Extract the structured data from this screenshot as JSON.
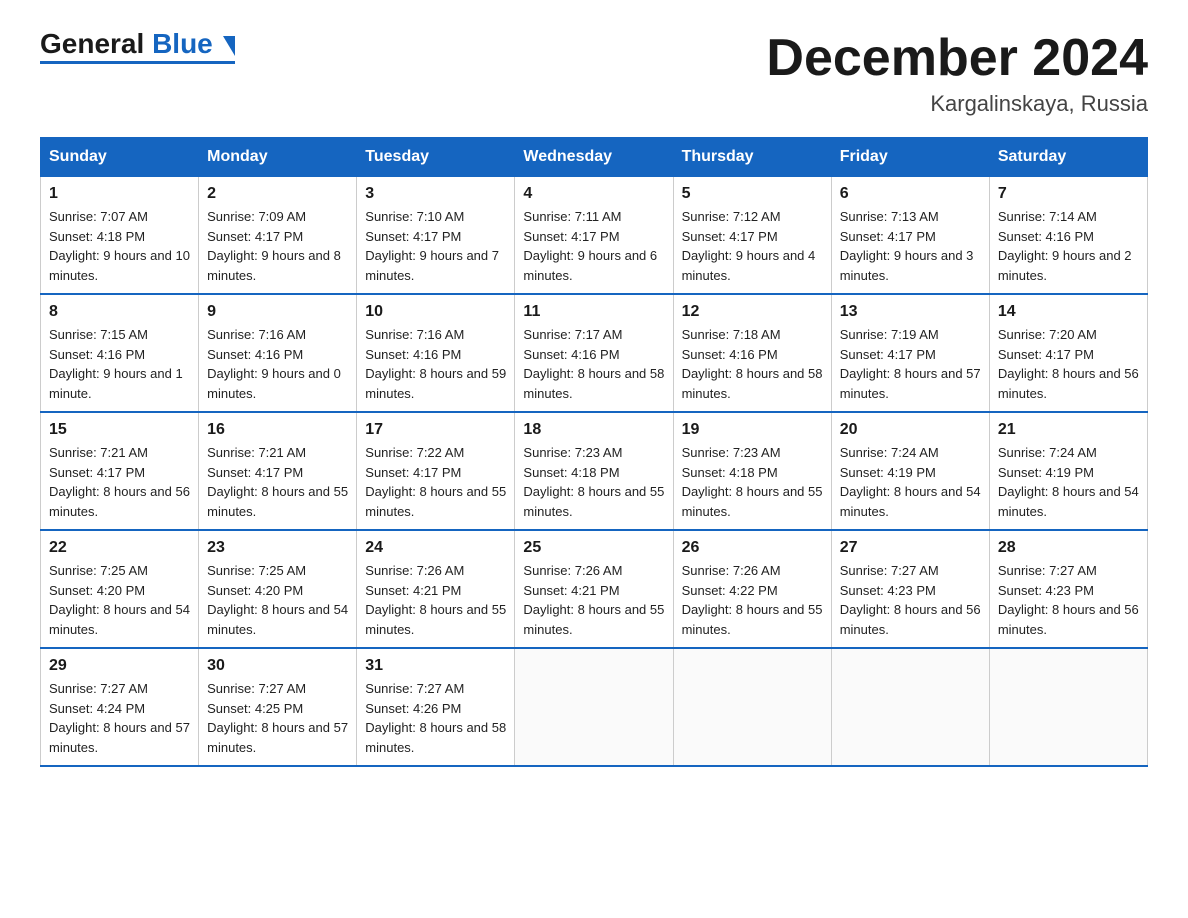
{
  "header": {
    "logo_general": "General",
    "logo_blue": "Blue",
    "month_title": "December 2024",
    "location": "Kargalinskaya, Russia"
  },
  "weekdays": [
    "Sunday",
    "Monday",
    "Tuesday",
    "Wednesday",
    "Thursday",
    "Friday",
    "Saturday"
  ],
  "weeks": [
    [
      {
        "day": "1",
        "sunrise": "7:07 AM",
        "sunset": "4:18 PM",
        "daylight": "9 hours and 10 minutes."
      },
      {
        "day": "2",
        "sunrise": "7:09 AM",
        "sunset": "4:17 PM",
        "daylight": "9 hours and 8 minutes."
      },
      {
        "day": "3",
        "sunrise": "7:10 AM",
        "sunset": "4:17 PM",
        "daylight": "9 hours and 7 minutes."
      },
      {
        "day": "4",
        "sunrise": "7:11 AM",
        "sunset": "4:17 PM",
        "daylight": "9 hours and 6 minutes."
      },
      {
        "day": "5",
        "sunrise": "7:12 AM",
        "sunset": "4:17 PM",
        "daylight": "9 hours and 4 minutes."
      },
      {
        "day": "6",
        "sunrise": "7:13 AM",
        "sunset": "4:17 PM",
        "daylight": "9 hours and 3 minutes."
      },
      {
        "day": "7",
        "sunrise": "7:14 AM",
        "sunset": "4:16 PM",
        "daylight": "9 hours and 2 minutes."
      }
    ],
    [
      {
        "day": "8",
        "sunrise": "7:15 AM",
        "sunset": "4:16 PM",
        "daylight": "9 hours and 1 minute."
      },
      {
        "day": "9",
        "sunrise": "7:16 AM",
        "sunset": "4:16 PM",
        "daylight": "9 hours and 0 minutes."
      },
      {
        "day": "10",
        "sunrise": "7:16 AM",
        "sunset": "4:16 PM",
        "daylight": "8 hours and 59 minutes."
      },
      {
        "day": "11",
        "sunrise": "7:17 AM",
        "sunset": "4:16 PM",
        "daylight": "8 hours and 58 minutes."
      },
      {
        "day": "12",
        "sunrise": "7:18 AM",
        "sunset": "4:16 PM",
        "daylight": "8 hours and 58 minutes."
      },
      {
        "day": "13",
        "sunrise": "7:19 AM",
        "sunset": "4:17 PM",
        "daylight": "8 hours and 57 minutes."
      },
      {
        "day": "14",
        "sunrise": "7:20 AM",
        "sunset": "4:17 PM",
        "daylight": "8 hours and 56 minutes."
      }
    ],
    [
      {
        "day": "15",
        "sunrise": "7:21 AM",
        "sunset": "4:17 PM",
        "daylight": "8 hours and 56 minutes."
      },
      {
        "day": "16",
        "sunrise": "7:21 AM",
        "sunset": "4:17 PM",
        "daylight": "8 hours and 55 minutes."
      },
      {
        "day": "17",
        "sunrise": "7:22 AM",
        "sunset": "4:17 PM",
        "daylight": "8 hours and 55 minutes."
      },
      {
        "day": "18",
        "sunrise": "7:23 AM",
        "sunset": "4:18 PM",
        "daylight": "8 hours and 55 minutes."
      },
      {
        "day": "19",
        "sunrise": "7:23 AM",
        "sunset": "4:18 PM",
        "daylight": "8 hours and 55 minutes."
      },
      {
        "day": "20",
        "sunrise": "7:24 AM",
        "sunset": "4:19 PM",
        "daylight": "8 hours and 54 minutes."
      },
      {
        "day": "21",
        "sunrise": "7:24 AM",
        "sunset": "4:19 PM",
        "daylight": "8 hours and 54 minutes."
      }
    ],
    [
      {
        "day": "22",
        "sunrise": "7:25 AM",
        "sunset": "4:20 PM",
        "daylight": "8 hours and 54 minutes."
      },
      {
        "day": "23",
        "sunrise": "7:25 AM",
        "sunset": "4:20 PM",
        "daylight": "8 hours and 54 minutes."
      },
      {
        "day": "24",
        "sunrise": "7:26 AM",
        "sunset": "4:21 PM",
        "daylight": "8 hours and 55 minutes."
      },
      {
        "day": "25",
        "sunrise": "7:26 AM",
        "sunset": "4:21 PM",
        "daylight": "8 hours and 55 minutes."
      },
      {
        "day": "26",
        "sunrise": "7:26 AM",
        "sunset": "4:22 PM",
        "daylight": "8 hours and 55 minutes."
      },
      {
        "day": "27",
        "sunrise": "7:27 AM",
        "sunset": "4:23 PM",
        "daylight": "8 hours and 56 minutes."
      },
      {
        "day": "28",
        "sunrise": "7:27 AM",
        "sunset": "4:23 PM",
        "daylight": "8 hours and 56 minutes."
      }
    ],
    [
      {
        "day": "29",
        "sunrise": "7:27 AM",
        "sunset": "4:24 PM",
        "daylight": "8 hours and 57 minutes."
      },
      {
        "day": "30",
        "sunrise": "7:27 AM",
        "sunset": "4:25 PM",
        "daylight": "8 hours and 57 minutes."
      },
      {
        "day": "31",
        "sunrise": "7:27 AM",
        "sunset": "4:26 PM",
        "daylight": "8 hours and 58 minutes."
      },
      null,
      null,
      null,
      null
    ]
  ],
  "labels": {
    "sunrise": "Sunrise:",
    "sunset": "Sunset:",
    "daylight": "Daylight:"
  }
}
